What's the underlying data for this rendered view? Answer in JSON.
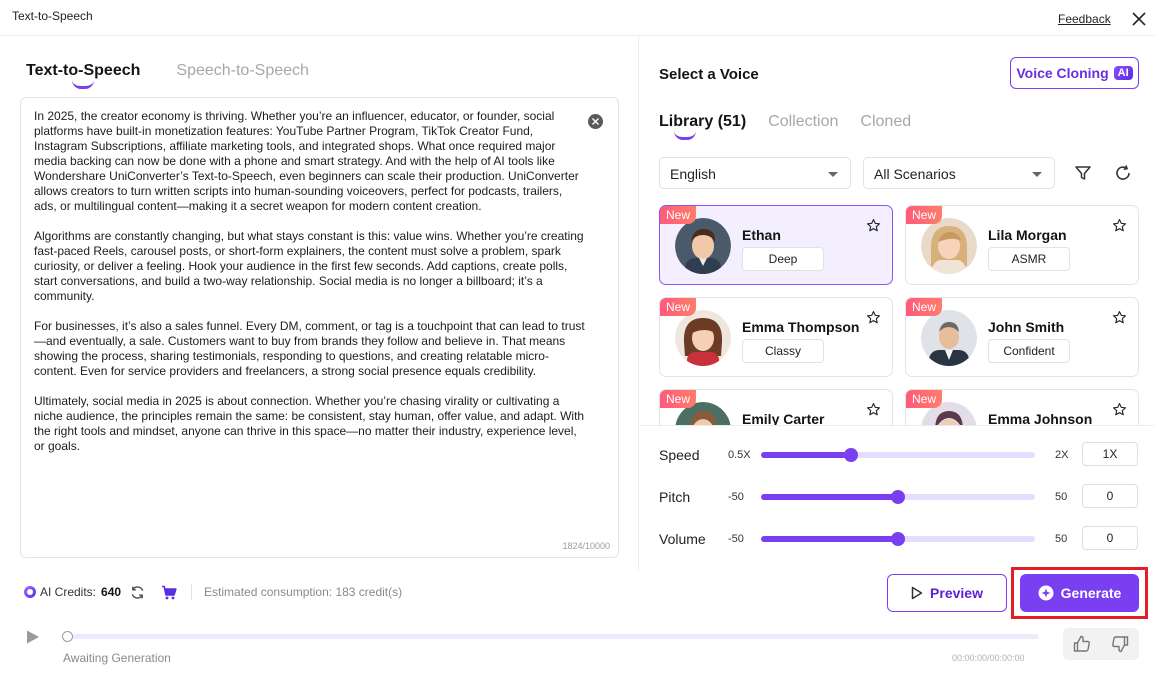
{
  "window": {
    "title": "Text-to-Speech",
    "feedback_label": "Feedback"
  },
  "left_tabs": [
    {
      "label": "Text-to-Speech",
      "active": true
    },
    {
      "label": "Speech-to-Speech",
      "active": false
    }
  ],
  "editor": {
    "text": "In 2025, the creator economy is thriving. Whether you’re an influencer, educator, or founder, social platforms have built-in monetization features: YouTube Partner Program, TikTok Creator Fund, Instagram Subscriptions, affiliate marketing tools, and integrated shops. What once required major media backing can now be done with a phone and smart strategy. And with the help of AI tools like Wondershare UniConverter’s Text-to-Speech, even beginners can scale their production. UniConverter allows creators to turn written scripts into human-sounding voiceovers, perfect for podcasts, trailers, ads, or multilingual content—making it a secret weapon for modern content creation.\n\nAlgorithms are constantly changing, but what stays constant is this: value wins. Whether you’re creating fast-paced Reels, carousel posts, or short-form explainers, the content must solve a problem, spark curiosity, or deliver a feeling. Hook your audience in the first few seconds. Add captions, create polls, start conversations, and build a two-way relationship. Social media is no longer a billboard; it’s a community.\n\nFor businesses, it’s also a sales funnel. Every DM, comment, or tag is a touchpoint that can lead to trust—and eventually, a sale. Customers want to buy from brands they follow and believe in. That means showing the process, sharing testimonials, responding to questions, and creating relatable micro-content. Even for service providers and freelancers, a strong social presence equals credibility.\n\nUltimately, social media in 2025 is about connection. Whether you’re chasing virality or cultivating a niche audience, the principles remain the same: be consistent, stay human, offer value, and adapt. With the right tools and mindset, anyone can thrive in this space—no matter their industry, experience level, or goals.",
    "char_count": "1824/10000"
  },
  "voice_panel": {
    "title": "Select a Voice",
    "voice_cloning_label": "Voice Cloning",
    "ai_badge": "AI",
    "tabs": [
      {
        "label": "Library (51)",
        "active": true
      },
      {
        "label": "Collection",
        "active": false
      },
      {
        "label": "Cloned",
        "active": false
      }
    ],
    "language": "English",
    "scenario": "All Scenarios",
    "voices": [
      {
        "badge": "New",
        "name": "Ethan",
        "tag": "Deep",
        "selected": true
      },
      {
        "badge": "New",
        "name": "Lila Morgan",
        "tag": "ASMR",
        "selected": false
      },
      {
        "badge": "New",
        "name": "Emma Thompson",
        "tag": "Classy",
        "selected": false
      },
      {
        "badge": "New",
        "name": "John Smith",
        "tag": "Confident",
        "selected": false
      },
      {
        "badge": "New",
        "name": "Emily Carter",
        "tag": "",
        "selected": false
      },
      {
        "badge": "New",
        "name": "Emma Johnson",
        "tag": "",
        "selected": false
      }
    ]
  },
  "sliders": {
    "speed": {
      "label": "Speed",
      "min_label": "0.5X",
      "max_label": "2X",
      "value_text": "1X",
      "fraction": 0.33
    },
    "pitch": {
      "label": "Pitch",
      "min_label": "-50",
      "max_label": "50",
      "value_text": "0",
      "fraction": 0.5
    },
    "volume": {
      "label": "Volume",
      "min_label": "-50",
      "max_label": "50",
      "value_text": "0",
      "fraction": 0.5
    }
  },
  "footer": {
    "credits_label": "AI Credits:",
    "credits_value": "640",
    "consumption": "Estimated consumption: 183 credit(s)",
    "preview_label": "Preview",
    "generate_label": "Generate"
  },
  "player": {
    "status": "Awaiting Generation",
    "time": "00:00:00/00:00:00",
    "progress": 0
  },
  "colors": {
    "accent": "#7b3ff2",
    "highlight": "#e21f26",
    "new_badge": "#ff5a7a"
  }
}
